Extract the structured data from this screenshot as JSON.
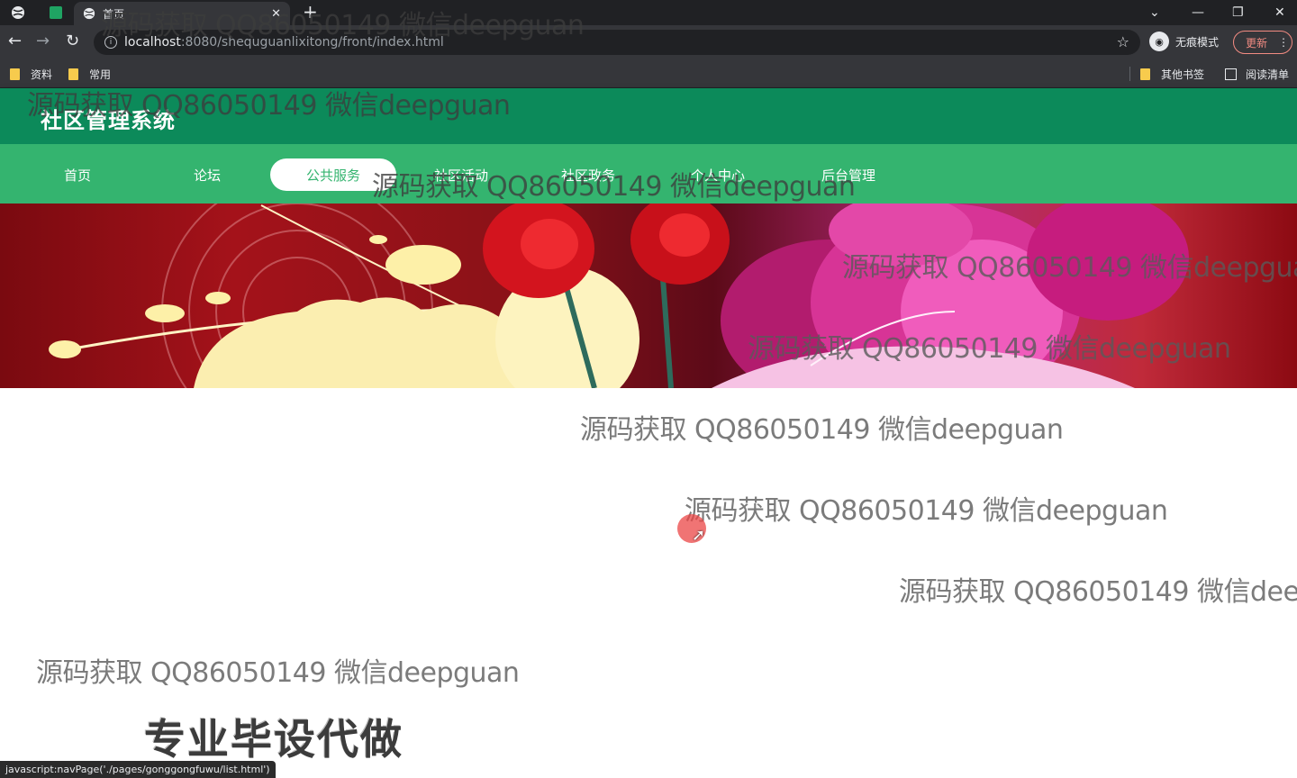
{
  "browser": {
    "tab_title": "首页",
    "url_host": "localhost",
    "url_path": ":8080/shequguanlixitong/front/index.html",
    "incognito_label": "无痕模式",
    "update_label": "更新",
    "bookmarks": [
      "资料",
      "常用"
    ],
    "bookmarks_right": [
      "其他书签",
      "阅读清单"
    ],
    "status_url": "javascript:navPage('./pages/gonggongfuwu/list.html')"
  },
  "site": {
    "title": "社区管理系统",
    "nav": [
      "首页",
      "论坛",
      "公共服务",
      "社区活动",
      "社区政务",
      "个人中心",
      "后台管理"
    ],
    "active_nav": "公共服务"
  },
  "overlay": {
    "watermark_text": "源码获取 QQ86050149 微信deepguan",
    "watermark_cut": "源码获取 QQ86050149 微信deepgua",
    "watermark_cut2": "源码获取 QQ86050149 微信dee",
    "promo": "专业毕设代做"
  },
  "colors": {
    "header": "#0c8a5a",
    "nav": "#34b46f",
    "cursor": "#eb4646"
  }
}
